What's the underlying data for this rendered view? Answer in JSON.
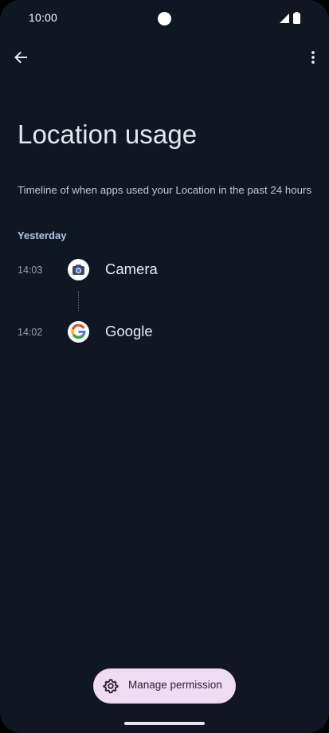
{
  "status_bar": {
    "time": "10:00",
    "icons": [
      "signal-icon",
      "battery-icon"
    ]
  },
  "top_bar": {
    "back_icon": "arrow-left-icon",
    "more_icon": "more-vertical-icon"
  },
  "page": {
    "title": "Location usage",
    "description": "Timeline of when apps used your Location in the past 24 hours"
  },
  "timeline": {
    "section_label": "Yesterday",
    "entries": [
      {
        "time": "14:03",
        "app": "Camera",
        "icon": "camera-app-icon"
      },
      {
        "time": "14:02",
        "app": "Google",
        "icon": "google-app-icon"
      }
    ]
  },
  "actions": {
    "manage_permission_label": "Manage permission",
    "manage_icon": "gear-icon"
  },
  "colors": {
    "background": "#111722",
    "section_accent": "#a9c7ea",
    "button_background": "#eedcf5"
  }
}
